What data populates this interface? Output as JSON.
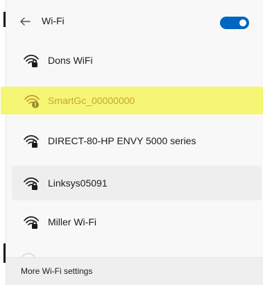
{
  "header": {
    "back_icon": "arrow-left-icon",
    "title": "Wi-Fi",
    "wifi_enabled": true,
    "toggle_color": "#0067c0"
  },
  "networks": [
    {
      "name": "Dons WiFi",
      "icon": "secured-wifi-icon"
    },
    {
      "name": "SmartGc_00000000",
      "icon": "warning-wifi-icon",
      "highlight_color": "#f6f675",
      "text_color": "#c8a62c"
    },
    {
      "name": "DIRECT-80-HP ENVY 5000 series",
      "icon": "secured-wifi-icon"
    },
    {
      "name": "Linksys05091",
      "icon": "secured-wifi-icon",
      "selected": true
    },
    {
      "name": "Miller Wi-Fi",
      "icon": "secured-wifi-icon"
    }
  ],
  "footer": {
    "label": "More Wi-Fi settings"
  }
}
